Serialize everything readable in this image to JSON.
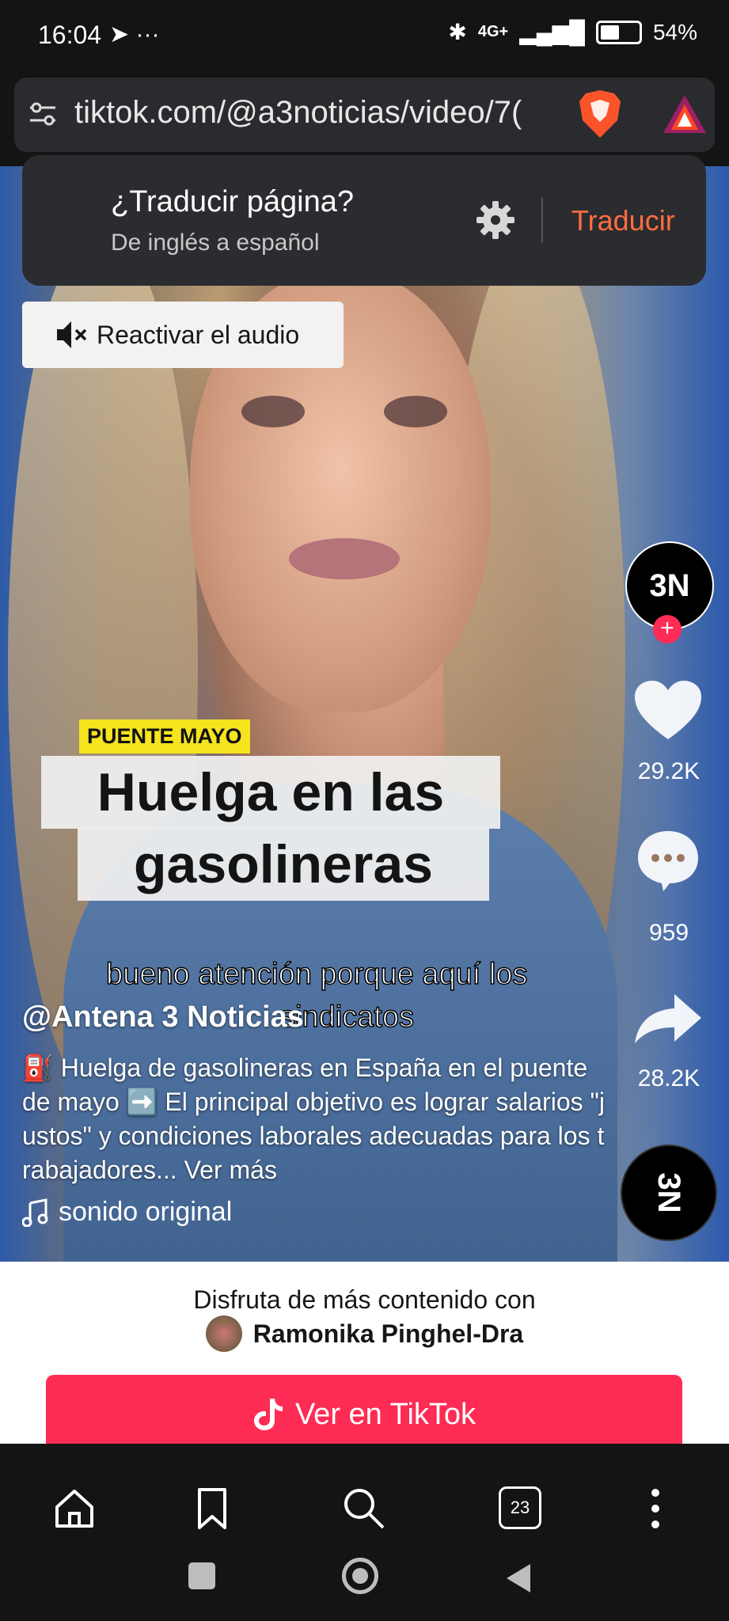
{
  "status_bar": {
    "time": "16:04",
    "extra_icons": "➤ ···",
    "network": "4G+",
    "battery": "54%",
    "battery_level": 0.54
  },
  "browser": {
    "url": "tiktok.com/@a3noticias/video/7("
  },
  "translate_prompt": {
    "title": "¿Traducir página?",
    "subtitle": "De inglés a español",
    "action": "Traducir"
  },
  "video": {
    "unmute_label": "Reactivar el audio",
    "badge": "PUENTE MAYO",
    "headline_line1": "Huelga en las",
    "headline_line2": "gasolineras",
    "subtitle_line1": "bueno atención porque aquí los",
    "subtitle_line2": "sindicatos",
    "author": "@Antena 3 Noticias",
    "caption": "⛽ Huelga de gasolineras en España en el puente de mayo ➡️ El principal objetivo es lograr salarios \"justos\" y condiciones laborales adecuadas para los trabajadores...",
    "see_more": "Ver más",
    "sound": "sonido original",
    "channel_logo": "3N"
  },
  "actions": {
    "likes": "29.2K",
    "comments": "959",
    "shares": "28.2K"
  },
  "promo": {
    "line1": "Disfruta de más contenido con",
    "user": "Ramonika Pinghel-Dra",
    "button": "Ver en TikTok"
  },
  "nav": {
    "tabs_count": "23"
  },
  "colors": {
    "accent": "#fe2c55",
    "translate_action": "#ff6d3f",
    "badge": "#f5e41e"
  }
}
